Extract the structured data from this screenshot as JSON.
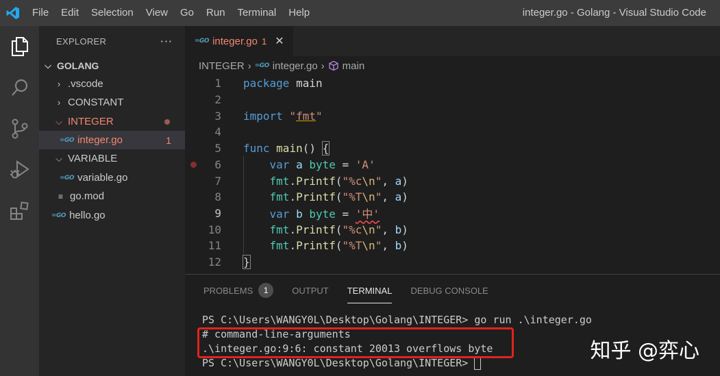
{
  "titlebar": {
    "menu": [
      "File",
      "Edit",
      "Selection",
      "View",
      "Go",
      "Run",
      "Terminal",
      "Help"
    ],
    "window_title": "integer.go - Golang - Visual Studio Code"
  },
  "activity_bar": {
    "icons": [
      "files-icon",
      "search-icon",
      "source-control-icon",
      "run-debug-icon",
      "extensions-icon"
    ]
  },
  "explorer": {
    "title": "EXPLORER",
    "more": "···",
    "root": "GOLANG",
    "items": [
      {
        "label": ".vscode",
        "type": "folder"
      },
      {
        "label": "CONSTANT",
        "type": "folder"
      },
      {
        "label": "INTEGER",
        "type": "folder-open"
      },
      {
        "label": "integer.go",
        "type": "go-file",
        "badge": "1"
      },
      {
        "label": "VARIABLE",
        "type": "folder-open"
      },
      {
        "label": "variable.go",
        "type": "go-file"
      },
      {
        "label": "go.mod",
        "type": "file"
      },
      {
        "label": "hello.go",
        "type": "go-file"
      }
    ]
  },
  "tab": {
    "label": "integer.go",
    "badge": "1",
    "close": "✕",
    "icon_text": "GO"
  },
  "breadcrumb": {
    "folder": "INTEGER",
    "file": "integer.go",
    "symbol": "main"
  },
  "editor": {
    "line_numbers": [
      "1",
      "2",
      "3",
      "4",
      "5",
      "6",
      "7",
      "8",
      "9",
      "10",
      "11",
      "12"
    ],
    "current_line": "9"
  },
  "panel": {
    "tabs": [
      "PROBLEMS",
      "OUTPUT",
      "TERMINAL",
      "DEBUG CONSOLE"
    ],
    "problems_count": "1",
    "terminal_lines": [
      "PS C:\\Users\\WANGY0L\\Desktop\\Golang\\INTEGER> go run .\\integer.go",
      "# command-line-arguments",
      ".\\integer.go:9:6: constant 20013 overflows byte",
      "PS C:\\Users\\WANGY0L\\Desktop\\Golang\\INTEGER> "
    ]
  },
  "watermark": "知乎 @弈心",
  "colors": {
    "accent": "#007acc",
    "error": "#f48771",
    "highlight_box": "#e0241e"
  }
}
